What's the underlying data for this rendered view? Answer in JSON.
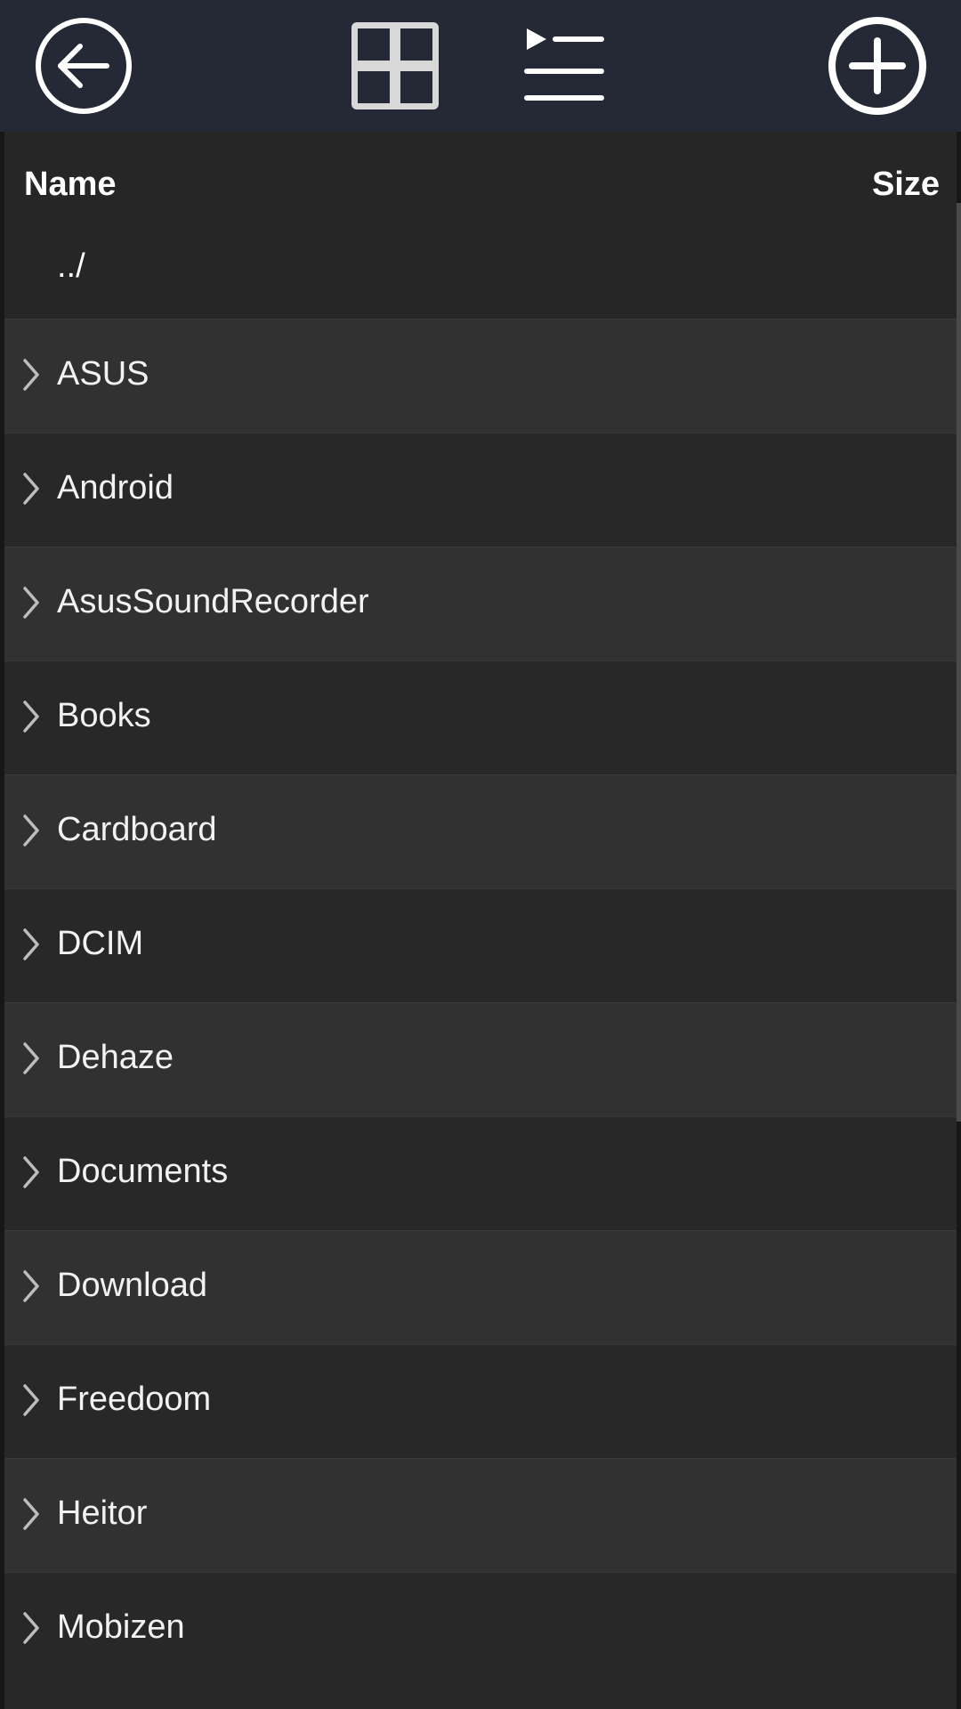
{
  "toolbar": {
    "back_icon": "back-arrow-circle-icon",
    "grid_icon": "grid-view-icon",
    "list_icon": "list-view-icon",
    "add_icon": "add-circle-icon"
  },
  "list": {
    "headers": {
      "name": "Name",
      "size": "Size"
    },
    "parent": "../",
    "folders": [
      "ASUS",
      "Android",
      "AsusSoundRecorder",
      "Books",
      "Cardboard",
      "DCIM",
      "Dehaze",
      "Documents",
      "Download",
      "Freedoom",
      "Heitor",
      "Mobizen"
    ]
  },
  "colors": {
    "toolbar_bg": "#252935",
    "row_alt": "#313131",
    "row_base": "#282828",
    "text": "#f2f2f2"
  }
}
